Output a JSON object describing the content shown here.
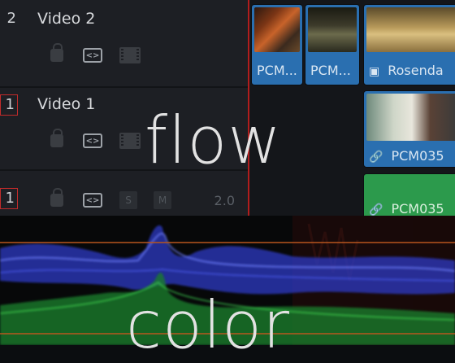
{
  "timeline": {
    "tracks": [
      {
        "number": "2",
        "name": "Video 2",
        "boxed": false
      },
      {
        "number": "1",
        "name": "Video 1",
        "boxed": true
      },
      {
        "number": "1",
        "name": "",
        "boxed": true,
        "audio_value": "2.0",
        "solo_label": "S",
        "mute_label": "M"
      }
    ],
    "clips": [
      {
        "label": "PCM...",
        "color": "#2a6fb0"
      },
      {
        "label": "PCM...",
        "color": "#2a6fb0"
      },
      {
        "label": "Rosenda",
        "color": "#2a6fb0"
      },
      {
        "label": "PCM035",
        "color": "#2a6fb0"
      },
      {
        "label": "PCM035",
        "color": "#2c9a4c"
      }
    ],
    "playhead_color": "#b11d1d"
  },
  "overlay": {
    "word_top": "flow",
    "word_bottom": "color"
  },
  "scope": {
    "guide_line_color": "#b8561e",
    "trace_colors": [
      "#3a4bd8",
      "#2aa33a",
      "#c0392b"
    ]
  }
}
